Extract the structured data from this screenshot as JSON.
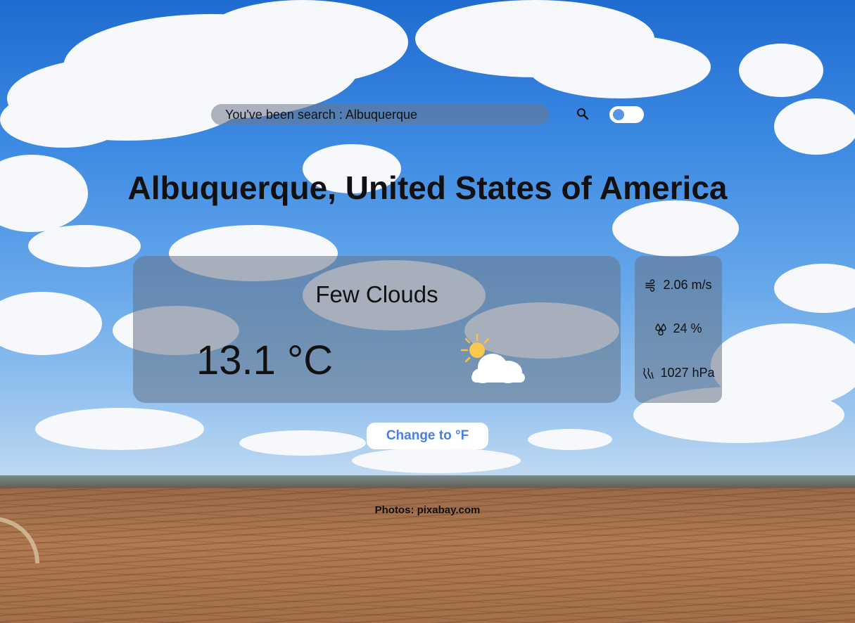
{
  "search": {
    "placeholder": "You've been search : Albuquerque"
  },
  "location": {
    "title": "Albuquerque, United States of America"
  },
  "weather": {
    "description": "Few Clouds",
    "temperature": "13.1 °C",
    "icon": "sun-behind-cloud-icon"
  },
  "stats": {
    "wind": "2.06 m/s",
    "humidity": "24 %",
    "pressure": "1027 hPa"
  },
  "unit_button": {
    "label": "Change to °F"
  },
  "footer": {
    "credit": "Photos: pixabay.com"
  },
  "colors": {
    "accent": "#4a7fe0",
    "toggle_knob": "#5b93e8",
    "panel": "rgba(100,115,135,0.55)"
  }
}
